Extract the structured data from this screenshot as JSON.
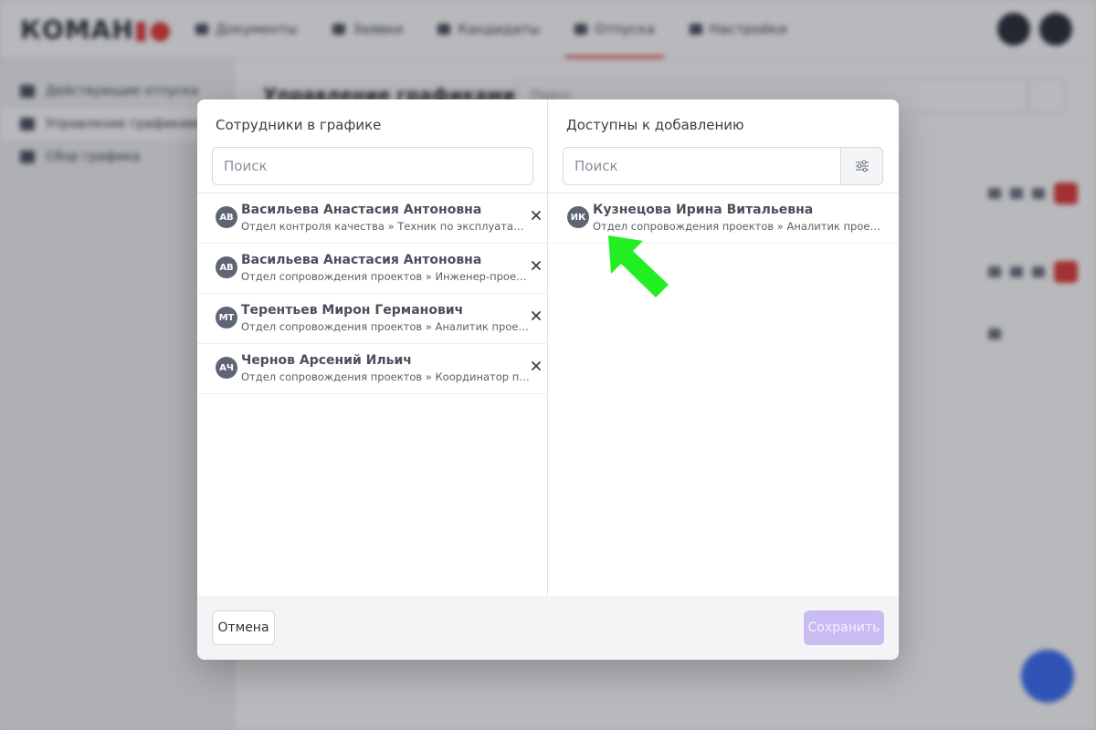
{
  "app": {
    "logo": "КОМАН",
    "nav": [
      {
        "label": "Документы"
      },
      {
        "label": "Заявки"
      },
      {
        "label": "Кандидаты"
      },
      {
        "label": "Отпуска"
      },
      {
        "label": "Настройки"
      }
    ],
    "sidebar": [
      {
        "label": "Действующие отпуска"
      },
      {
        "label": "Управление графиками"
      },
      {
        "label": "Сбор графика"
      }
    ],
    "main_title": "Управление графиками",
    "main_search_placeholder": "Поиск"
  },
  "modal": {
    "left": {
      "title": "Сотрудники в графике",
      "search_placeholder": "Поиск",
      "items": [
        {
          "initials": "АВ",
          "name": "Васильева Анастасия Антоновна",
          "sub": "Отдел контроля качества » Техник по эксплуатации и обслуживанию"
        },
        {
          "initials": "АВ",
          "name": "Васильева Анастасия Антоновна",
          "sub": "Отдел сопровождения проектов » Инженер-проектировщик"
        },
        {
          "initials": "МТ",
          "name": "Терентьев Мирон Германович",
          "sub": "Отдел сопровождения проектов » Аналитик проектов"
        },
        {
          "initials": "АЧ",
          "name": "Чернов Арсений Ильич",
          "sub": "Отдел сопровождения проектов » Координатор проектов"
        }
      ]
    },
    "right": {
      "title": "Доступны к добавлению",
      "search_placeholder": "Поиск",
      "items": [
        {
          "initials": "ИК",
          "name": "Кузнецова Ирина Витальевна",
          "sub": "Отдел сопровождения проектов » Аналитик проектов"
        }
      ]
    },
    "footer": {
      "cancel_label": "Отмена",
      "save_label": "Сохранить"
    }
  },
  "colors": {
    "accent": "#e23b3b",
    "save_disabled": "#c8bcf2",
    "avatar": "#5f6575",
    "pointer_arrow": "#22ee22"
  },
  "icons": {
    "remove": "close-icon",
    "filter": "sliders-icon",
    "pointer": "arrow-pointer-icon"
  }
}
